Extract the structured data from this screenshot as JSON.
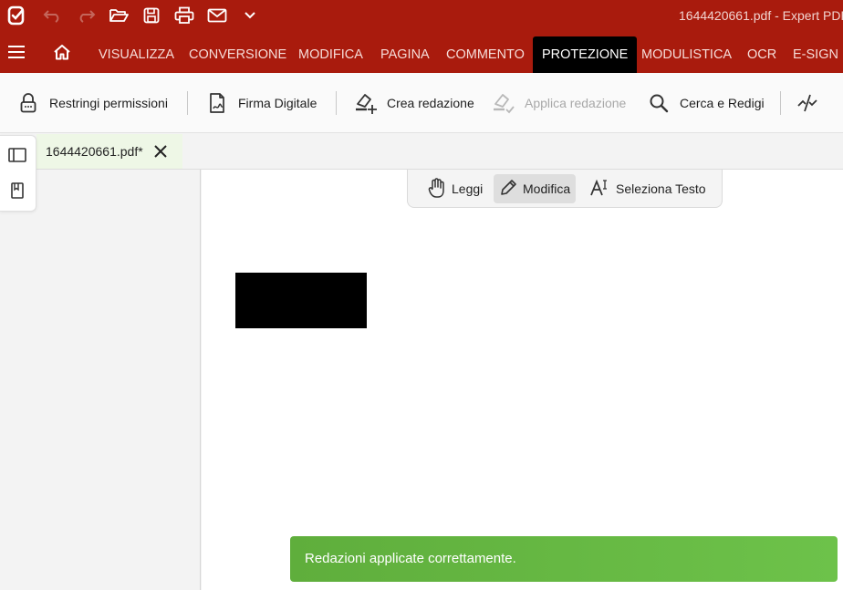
{
  "titlebar": {
    "title": "1644420661.pdf  -  Expert PDF",
    "quick_access": [
      "app-logo-icon",
      "undo-icon",
      "redo-icon",
      "open-folder-icon",
      "save-icon",
      "print-icon",
      "mail-icon",
      "chevron-down-icon"
    ]
  },
  "menu": {
    "items": [
      {
        "label": "VISUALIZZA"
      },
      {
        "label": "CONVERSIONE"
      },
      {
        "label": "MODIFICA"
      },
      {
        "label": "PAGINA"
      },
      {
        "label": "COMMENTO"
      },
      {
        "label": "PROTEZIONE",
        "active": true
      },
      {
        "label": "MODULISTICA"
      },
      {
        "label": "OCR"
      },
      {
        "label": "E-SIGN"
      }
    ]
  },
  "ribbon": {
    "restrict": "Restringi permissioni",
    "digital_signature": "Firma Digitale",
    "create_redaction": "Crea redazione",
    "apply_redaction": "Applica redazione",
    "search_redact": "Cerca e Redigi"
  },
  "document_tab": {
    "name": "1644420661.pdf*"
  },
  "modes": {
    "read": "Leggi",
    "edit": "Modifica",
    "select_text": "Seleziona Testo",
    "active": "Modifica"
  },
  "toast": {
    "message": "Redazioni applicate correttamente."
  },
  "colors": {
    "brand": "#a91b0d",
    "toast": "#67b843"
  }
}
